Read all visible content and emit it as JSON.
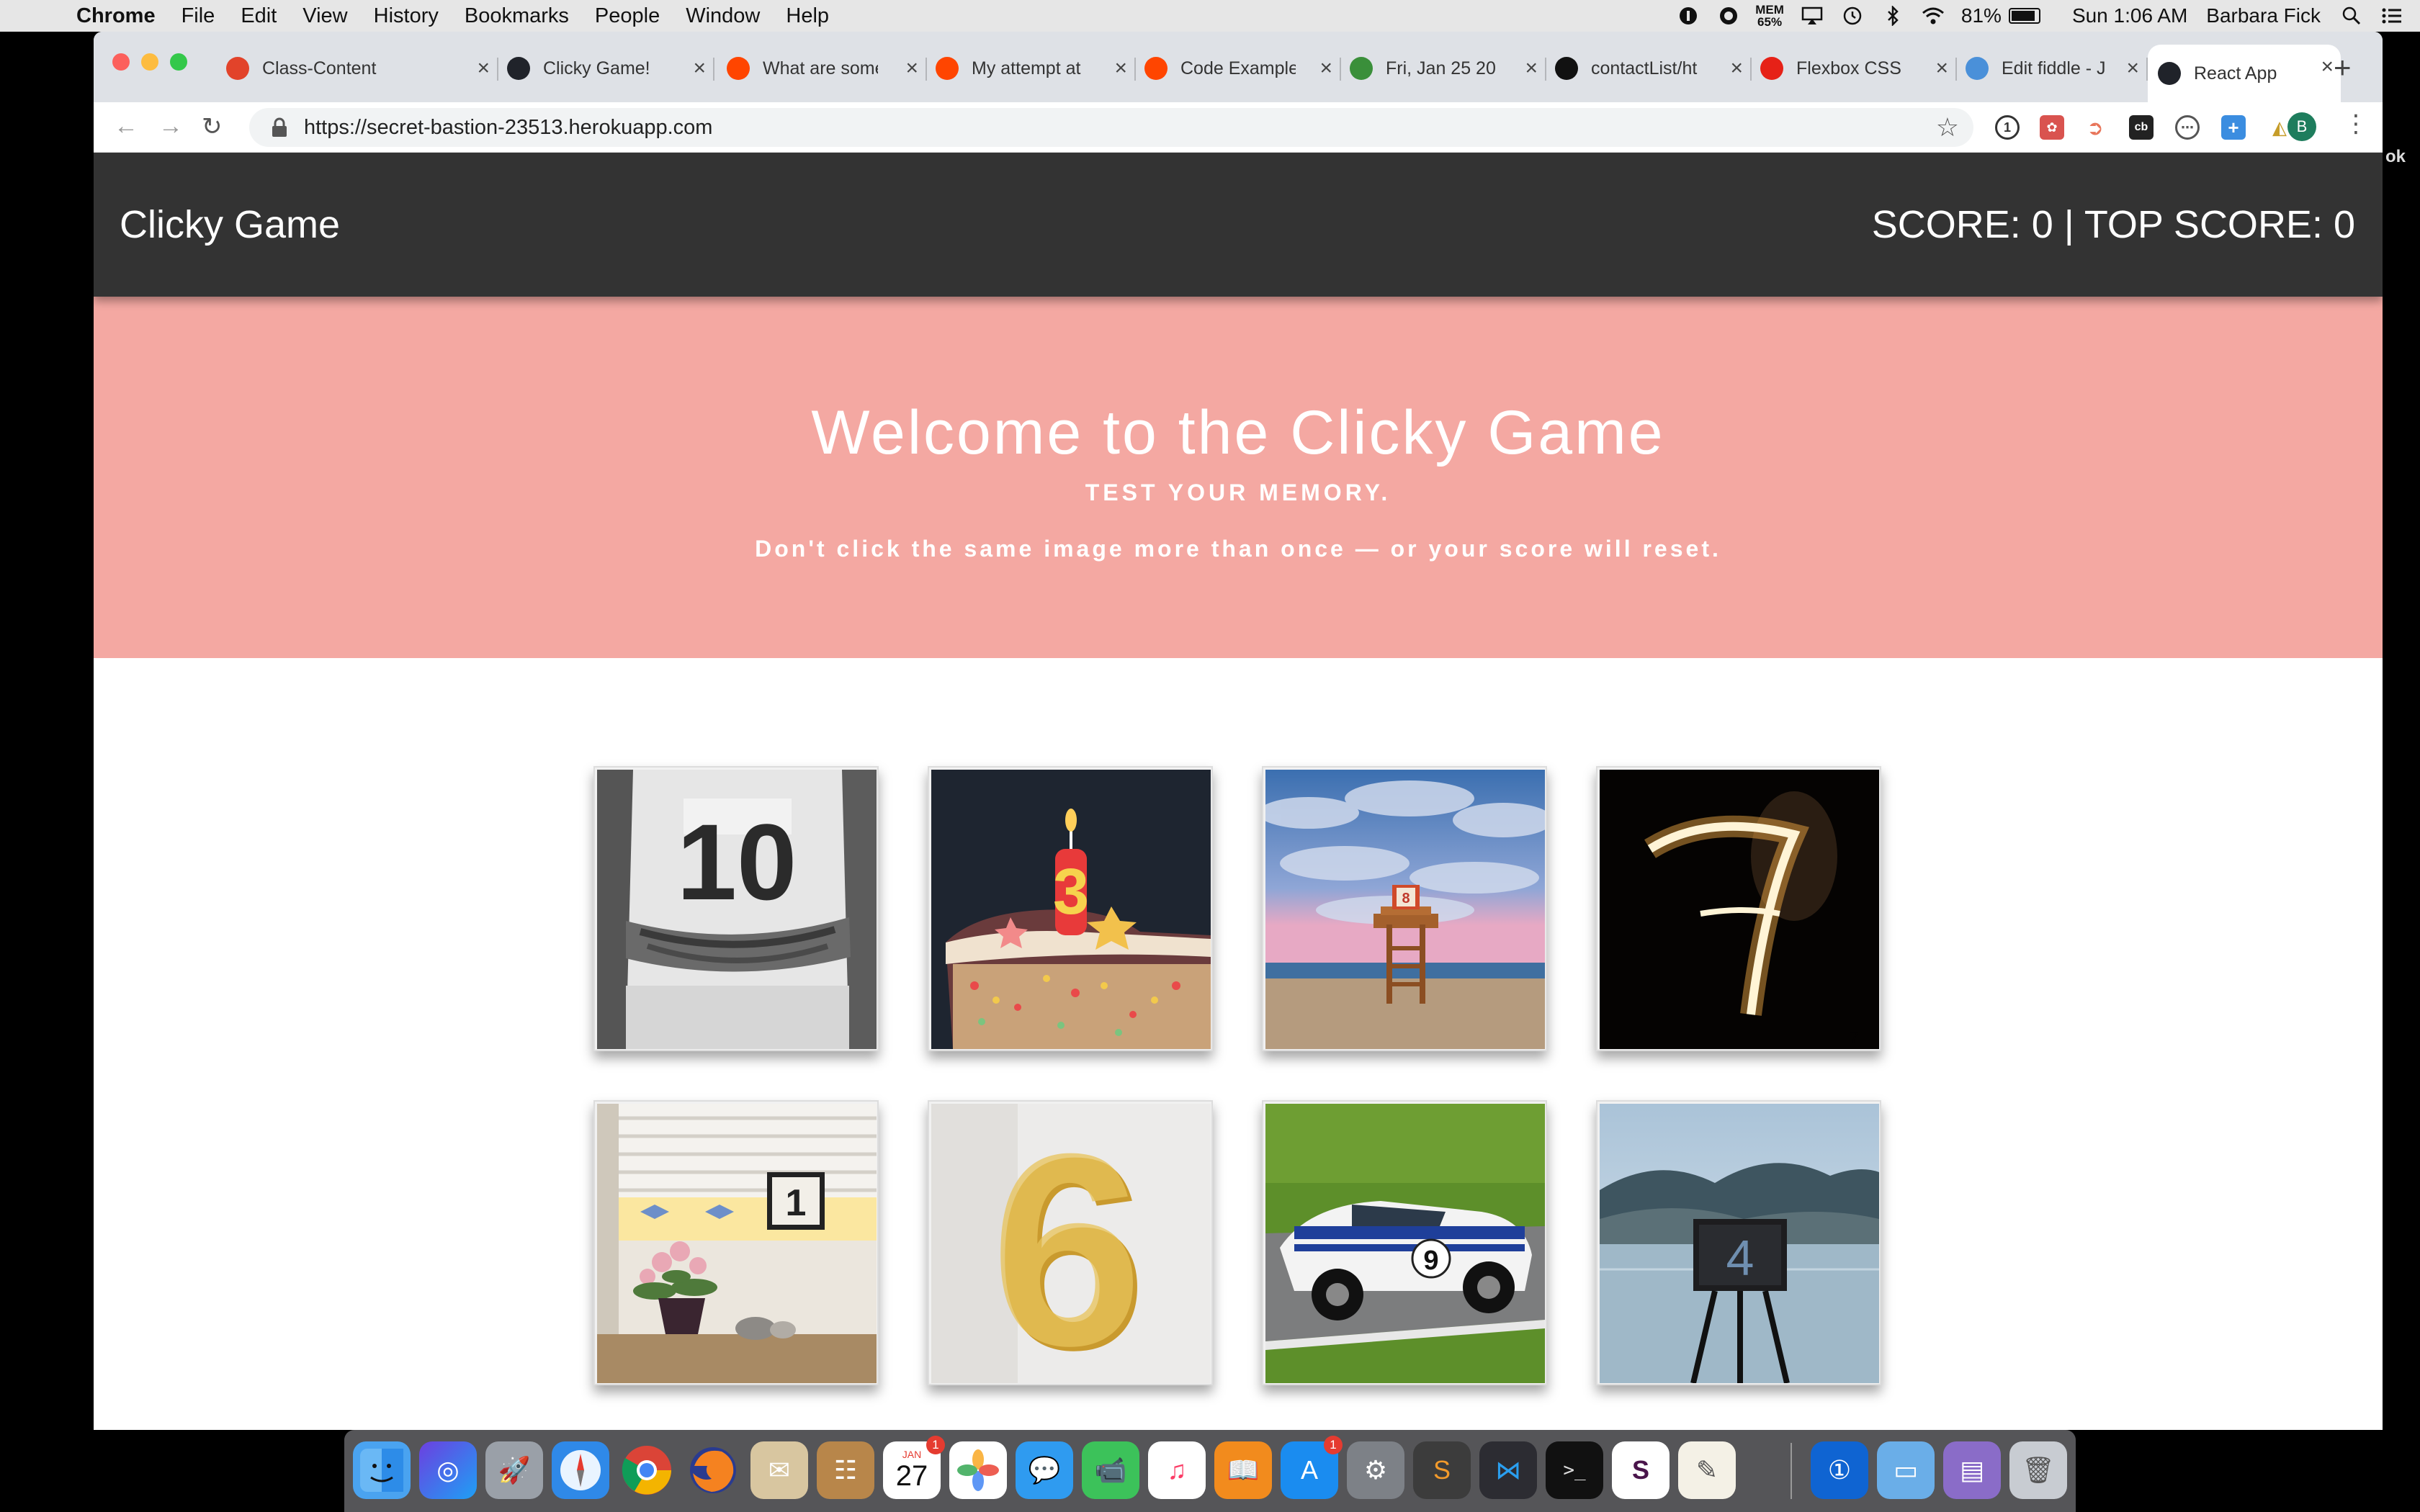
{
  "menubar": {
    "app": "Chrome",
    "items": [
      "File",
      "Edit",
      "View",
      "History",
      "Bookmarks",
      "People",
      "Window",
      "Help"
    ],
    "mem_label": "MEM",
    "mem_value": "65%",
    "battery": "81%",
    "clock": "Sun 1:06 AM",
    "user": "Barbara Fick"
  },
  "tabs": [
    {
      "title": "Class-Content",
      "icon": "gitlab-icon",
      "color": "#e2432a"
    },
    {
      "title": "Clicky Game!",
      "icon": "react-icon",
      "color": "#20232a"
    },
    {
      "title": "What are some",
      "icon": "reddit-icon",
      "color": "#ff4500"
    },
    {
      "title": "My attempt at",
      "icon": "reddit-icon",
      "color": "#ff4500"
    },
    {
      "title": "Code Example",
      "icon": "reddit-icon",
      "color": "#ff4500"
    },
    {
      "title": "Fri, Jan 25 20",
      "icon": "recycle-icon",
      "color": "#3a8f3a"
    },
    {
      "title": "contactList/ht",
      "icon": "github-icon",
      "color": "#111111"
    },
    {
      "title": "Flexbox CSS",
      "icon": "youtube-icon",
      "color": "#e62117"
    },
    {
      "title": "Edit fiddle - J",
      "icon": "cloud-icon",
      "color": "#4a90d9"
    },
    {
      "title": "React App",
      "icon": "react-icon",
      "color": "#20232a",
      "active": true
    }
  ],
  "url": "https://secret-bastion-23513.herokuapp.com",
  "profile_initial": "B",
  "edge_text": "ok",
  "app": {
    "brand": "Clicky Game",
    "score_text": "SCORE: 0 | TOP SCORE: 0",
    "hero_title": "Welcome to the Clicky Game",
    "hero_subtitle": "TEST YOUR MEMORY.",
    "hero_note": "Don't click the same image more than once — or your score will reset.",
    "colors": {
      "navbar": "#333333",
      "hero": "#f4a8a2"
    },
    "cards": [
      {
        "name": "card-jersey-10",
        "number": "10"
      },
      {
        "name": "card-cake-3",
        "number": "3"
      },
      {
        "name": "card-lifeguard-8",
        "number": "8"
      },
      {
        "name": "card-sparkler-7",
        "number": "7"
      },
      {
        "name": "card-window-1",
        "number": "1"
      },
      {
        "name": "card-balloon-6",
        "number": "6"
      },
      {
        "name": "card-racecar-9",
        "number": "9"
      },
      {
        "name": "card-lake-4",
        "number": "4"
      }
    ]
  },
  "dock": {
    "calendar_month": "JAN",
    "calendar_day": "27",
    "calendar_badge": "1",
    "appstore_badge": "1"
  }
}
